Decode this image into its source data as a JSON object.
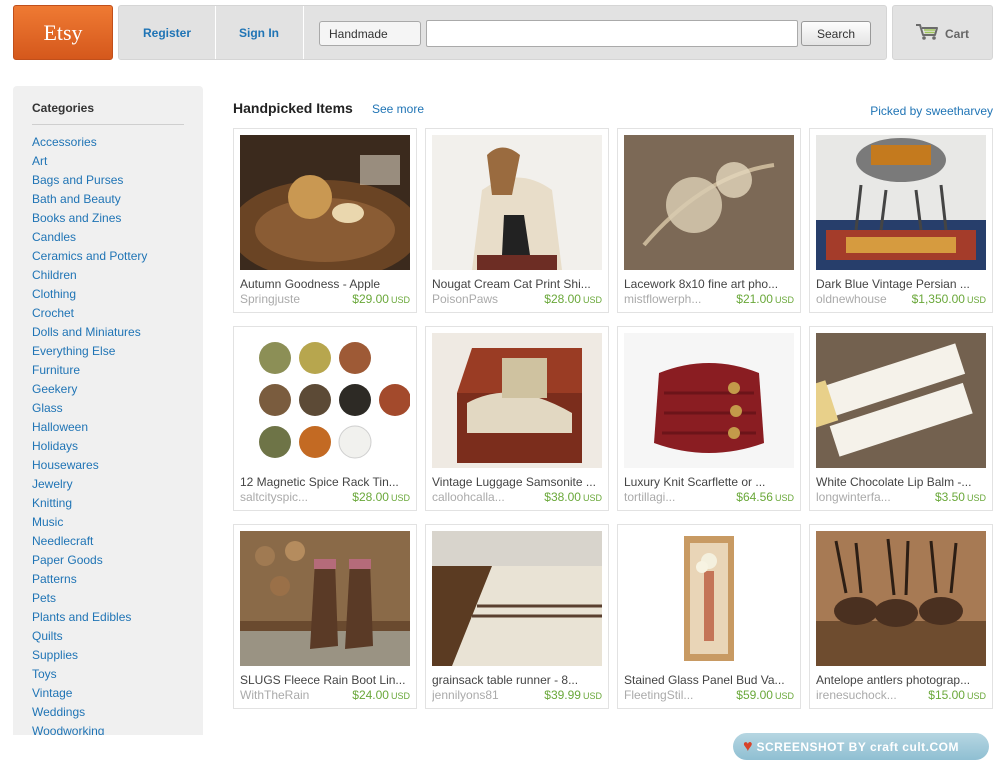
{
  "header": {
    "logo_text": "Etsy",
    "nav": {
      "register": "Register",
      "sign_in": "Sign In"
    },
    "search": {
      "scope": "Handmade",
      "placeholder": "",
      "button": "Search"
    },
    "cart_label": "Cart"
  },
  "sidebar": {
    "title": "Categories",
    "items": [
      "Accessories",
      "Art",
      "Bags and Purses",
      "Bath and Beauty",
      "Books and Zines",
      "Candles",
      "Ceramics and Pottery",
      "Children",
      "Clothing",
      "Crochet",
      "Dolls and Miniatures",
      "Everything Else",
      "Furniture",
      "Geekery",
      "Glass",
      "Halloween",
      "Holidays",
      "Housewares",
      "Jewelry",
      "Knitting",
      "Music",
      "Needlecraft",
      "Paper Goods",
      "Patterns",
      "Pets",
      "Plants and Edibles",
      "Quilts",
      "Supplies",
      "Toys",
      "Vintage",
      "Weddings",
      "Woodworking"
    ]
  },
  "main": {
    "section_title": "Handpicked Items",
    "see_more": "See more",
    "picked_by": "Picked by sweetharvey",
    "currency": "USD",
    "items": [
      {
        "title": "Autumn Goodness - Apple",
        "shop": "Springjuste",
        "price": "$29.00",
        "image": "apple-photo"
      },
      {
        "title": "Nougat Cream Cat Print Shi...",
        "shop": "PoisonPaws",
        "price": "$28.00",
        "image": "cat-shirt-photo"
      },
      {
        "title": "Lacework 8x10 fine art pho...",
        "shop": "mistflowerph...",
        "price": "$21.00",
        "image": "dried-flower-photo"
      },
      {
        "title": "Dark Blue Vintage Persian ...",
        "shop": "oldnewhouse",
        "price": "$1,350.00",
        "image": "persian-rug-photo"
      },
      {
        "title": "12 Magnetic Spice Rack Tin...",
        "shop": "saltcityspic...",
        "price": "$28.00",
        "image": "spice-tins-photo"
      },
      {
        "title": "Vintage Luggage Samsonite ...",
        "shop": "calloohcalla...",
        "price": "$38.00",
        "image": "luggage-photo"
      },
      {
        "title": "Luxury Knit Scarflette or ...",
        "shop": "tortillagi...",
        "price": "$64.56",
        "image": "knit-scarf-photo"
      },
      {
        "title": "White Chocolate Lip Balm -...",
        "shop": "longwinterfa...",
        "price": "$3.50",
        "image": "lip-balm-photo"
      },
      {
        "title": "SLUGS Fleece Rain Boot Lin...",
        "shop": "WithTheRain",
        "price": "$24.00",
        "image": "rain-boots-photo"
      },
      {
        "title": "grainsack table runner - 8...",
        "shop": "jennilyons81",
        "price": "$39.99",
        "image": "table-runner-photo"
      },
      {
        "title": "Stained Glass Panel Bud Va...",
        "shop": "FleetingStil...",
        "price": "$59.00",
        "image": "bud-vase-photo"
      },
      {
        "title": "Antelope antlers photograp...",
        "shop": "irenesuchock...",
        "price": "$15.00",
        "image": "antelope-photo"
      }
    ]
  },
  "badge": {
    "text": "SCREENSHOT BY craft cult.COM"
  }
}
